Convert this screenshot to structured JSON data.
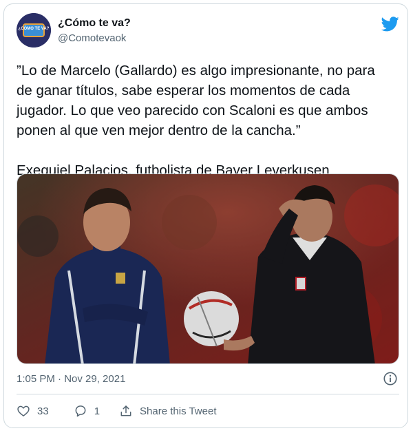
{
  "author": {
    "display_name": "¿Cómo te va?",
    "handle": "@Comotevaok",
    "avatar_text": "¿CÓMO TE VA?"
  },
  "tweet": {
    "text": "”Lo de Marcelo (Gallardo) es algo impresionante, no para\nde ganar títulos, sabe esperar los momentos de cada\njugador. Lo que veo parecido con Scaloni es que ambos\nponen al que ven mejor dentro de la cancha.”\n\nExequiel Palacios, futbolista de Bayer Leverkusen",
    "timestamp": "1:05 PM · Nov 29, 2021"
  },
  "actions": {
    "like_count": "33",
    "reply_count": "1",
    "share_label": "Share this Tweet"
  },
  "icons": {
    "brand": "twitter-bird-icon",
    "info": "info-icon",
    "like": "heart-icon",
    "reply": "reply-icon",
    "share": "share-icon"
  },
  "colors": {
    "brand": "#1d9bf0",
    "text_secondary": "#536471",
    "border": "#cfd9de"
  }
}
